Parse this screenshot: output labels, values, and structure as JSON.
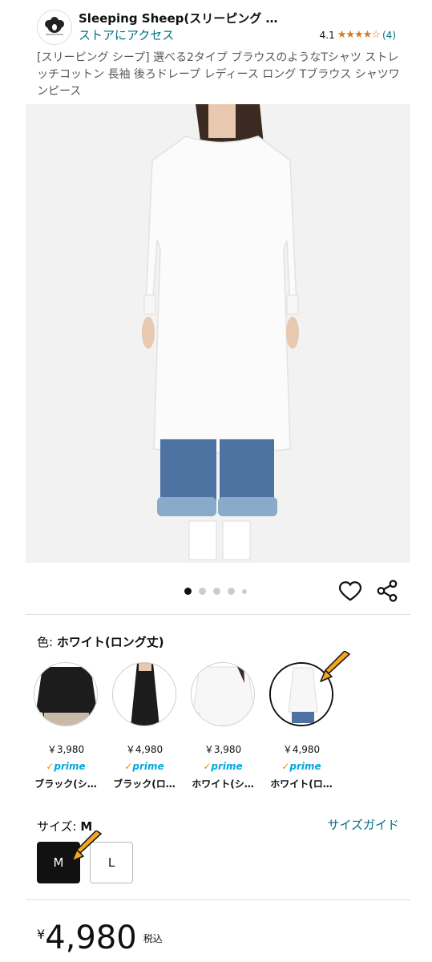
{
  "store": {
    "name": "Sleeping Sheep(スリーピング …",
    "visit_label": "ストアにアクセス",
    "rating_value": "4.1",
    "rating_stars": "★★★★☆",
    "rating_count": "(4)"
  },
  "product": {
    "title": "[スリーピング シープ] 選べる2タイプ ブラウスのようなTシャツ ストレッチコットン 長袖 後ろドレープ レディース ロング Tブラウス シャツワンピース"
  },
  "gallery": {
    "dot_count": 5,
    "active_index": 0
  },
  "color": {
    "label": "色:",
    "selected": "ホワイト(ロング丈)",
    "options": [
      {
        "price": "￥3,980",
        "prime": "prime",
        "name": "ブラック(シ…"
      },
      {
        "price": "￥4,980",
        "prime": "prime",
        "name": "ブラック(ロ…"
      },
      {
        "price": "￥3,980",
        "prime": "prime",
        "name": "ホワイト(シ…"
      },
      {
        "price": "￥4,980",
        "prime": "prime",
        "name": "ホワイト(ロ…"
      }
    ]
  },
  "size": {
    "label": "サイズ:",
    "selected": "M",
    "guide_label": "サイズガイド",
    "options": [
      "M",
      "L"
    ]
  },
  "price": {
    "yen": "¥",
    "amount": "4,980",
    "tax_label": "税込"
  },
  "colors": {
    "link": "#007185",
    "star": "#de7921",
    "prime_blue": "#00a8e1",
    "arrow": "#f5a623"
  }
}
